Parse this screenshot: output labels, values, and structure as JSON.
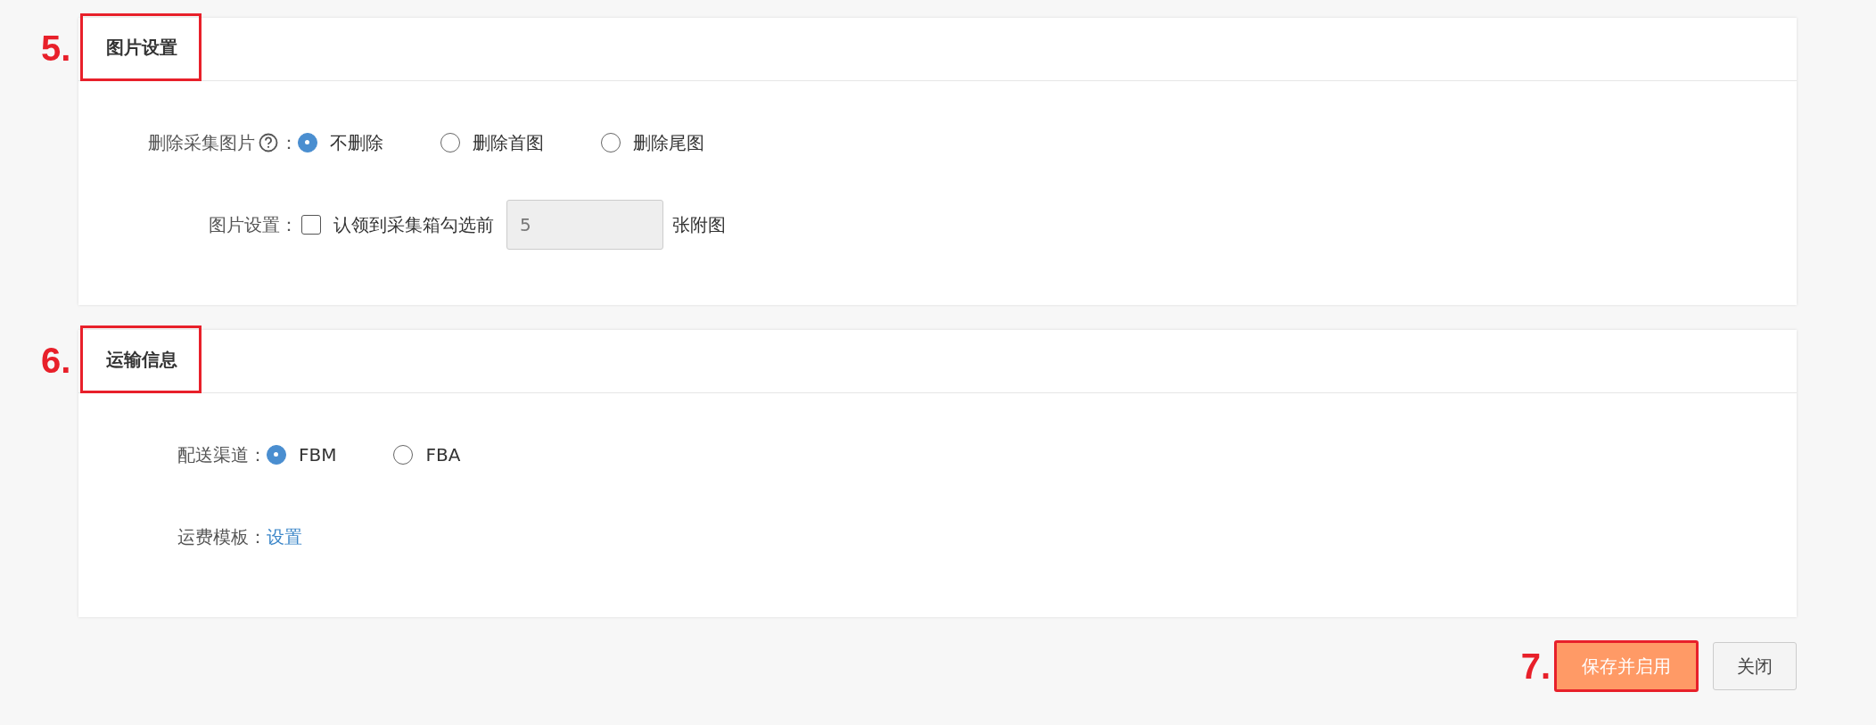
{
  "sections": [
    {
      "step": "5.",
      "title": "图片设置",
      "rows": [
        {
          "kind": "radio",
          "label": "删除采集图片",
          "help": true,
          "label_suffix": "：",
          "options": [
            {
              "label": "不删除",
              "selected": true
            },
            {
              "label": "删除首图",
              "selected": false
            },
            {
              "label": "删除尾图",
              "selected": false
            }
          ]
        },
        {
          "kind": "checkbox",
          "label": "图片设置：",
          "checked": false,
          "text": "认领到采集箱勾选前",
          "value": "5",
          "disabled": true,
          "suffix": "张附图"
        }
      ]
    },
    {
      "step": "6.",
      "title": "运输信息",
      "rows": [
        {
          "kind": "radio",
          "label": "配送渠道：",
          "options": [
            {
              "label": "FBM",
              "selected": true
            },
            {
              "label": "FBA",
              "selected": false
            }
          ]
        },
        {
          "kind": "link",
          "label": "运费模板：",
          "link": "设置"
        }
      ]
    }
  ],
  "buttons": [
    {
      "kind": "primary",
      "label": "保存并启用",
      "step": "7."
    },
    {
      "kind": "default",
      "label": "关闭"
    }
  ]
}
